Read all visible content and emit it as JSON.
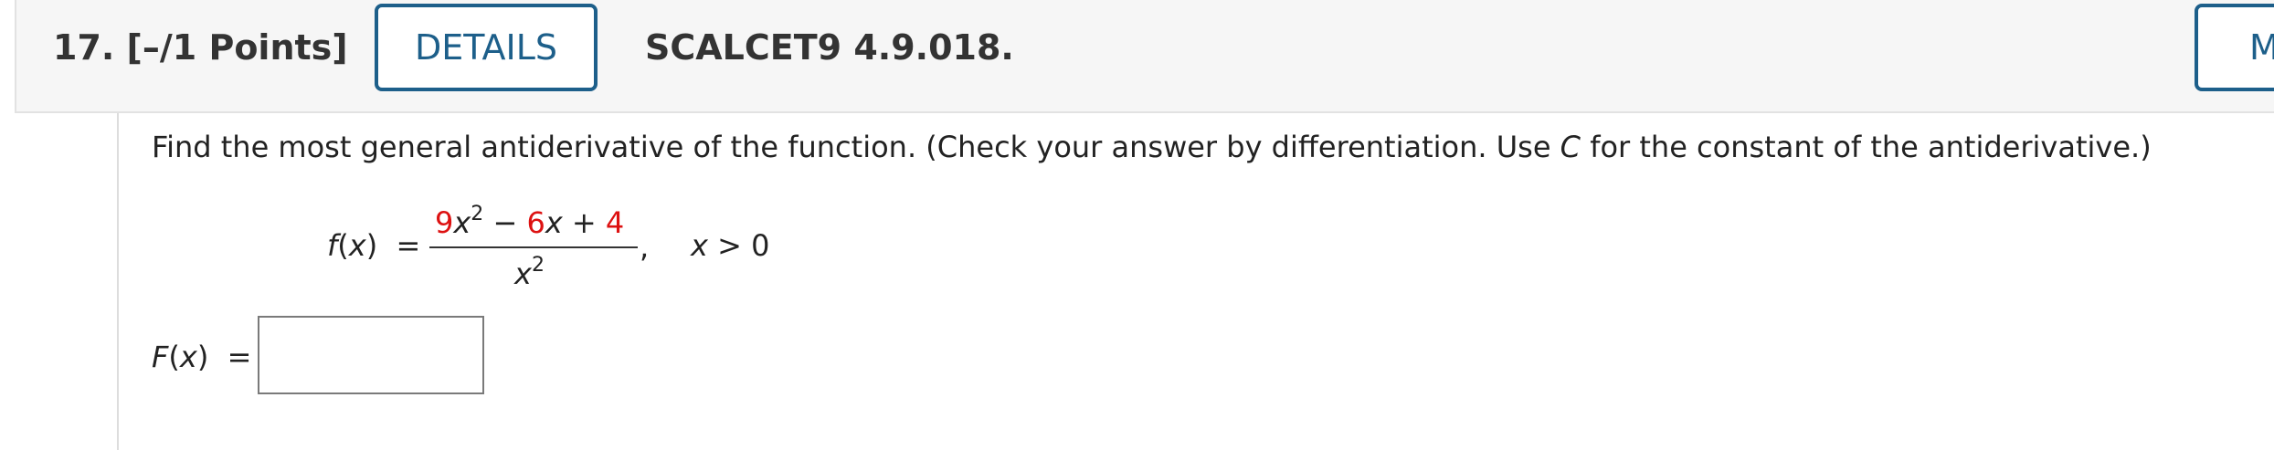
{
  "question": {
    "number_points": "17.  [–/1 Points]",
    "details_label": "DETAILS",
    "problem_id": "SCALCET9 4.9.018.",
    "my_label": "MY"
  },
  "body": {
    "instructions_pre": "Find the most general antiderivative of the function. (Check your answer by differentiation. Use ",
    "instructions_var": "C",
    "instructions_post": " for the constant of the antiderivative.)",
    "function": {
      "name": "f",
      "arg": "x",
      "equals": "=",
      "coef_a": "9",
      "term_a_var": "x",
      "term_a_exp": "2",
      "minus": "−",
      "coef_b": "6",
      "term_b_var": "x",
      "plus": "+",
      "const_c": "4",
      "den_var": "x",
      "den_exp": "2",
      "comma": ",",
      "condition_var": "x",
      "condition_rest": "> 0"
    },
    "answer": {
      "name": "F",
      "arg": "x",
      "equals": "=",
      "value": "",
      "placeholder": ""
    }
  },
  "colors": {
    "accent": "#1d5f8a",
    "highlight": "#dd1111",
    "header_bg": "#f6f6f6"
  }
}
